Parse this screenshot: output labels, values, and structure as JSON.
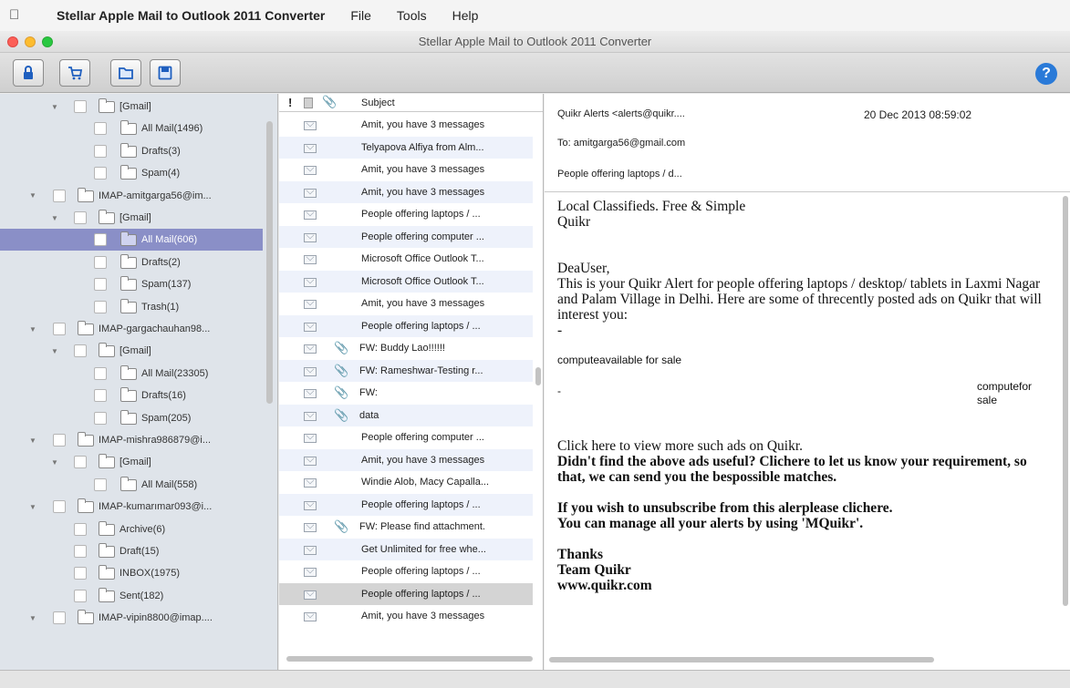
{
  "menubar": {
    "app": "Stellar Apple Mail to Outlook 2011 Converter",
    "items": [
      "File",
      "Tools",
      "Help"
    ]
  },
  "window": {
    "title": "Stellar Apple Mail to Outlook 2011 Converter"
  },
  "toolbar": {
    "help": "?"
  },
  "tree": [
    {
      "label": "[Gmail]",
      "level": 2,
      "expanded": true
    },
    {
      "label": "All Mail(1496)",
      "level": 3
    },
    {
      "label": "Drafts(3)",
      "level": 3
    },
    {
      "label": "Spam(4)",
      "level": 3
    },
    {
      "label": "IMAP-amitgarga56@im...",
      "level": 1,
      "expanded": true,
      "account": true
    },
    {
      "label": "[Gmail]",
      "level": 2,
      "expanded": true
    },
    {
      "label": "All Mail(606)",
      "level": 3,
      "selected": true
    },
    {
      "label": "Drafts(2)",
      "level": 3
    },
    {
      "label": "Spam(137)",
      "level": 3
    },
    {
      "label": "Trash(1)",
      "level": 3
    },
    {
      "label": "IMAP-gargachauhan98...",
      "level": 1,
      "expanded": true,
      "account": true
    },
    {
      "label": "[Gmail]",
      "level": 2,
      "expanded": true
    },
    {
      "label": "All Mail(23305)",
      "level": 3
    },
    {
      "label": "Drafts(16)",
      "level": 3
    },
    {
      "label": "Spam(205)",
      "level": 3
    },
    {
      "label": "IMAP-mishra986879@i...",
      "level": 1,
      "expanded": true,
      "account": true
    },
    {
      "label": "[Gmail]",
      "level": 2,
      "expanded": true
    },
    {
      "label": "All Mail(558)",
      "level": 3
    },
    {
      "label": "IMAP-kumarımar093@i...",
      "level": 1,
      "expanded": true,
      "account": true
    },
    {
      "label": "Archive(6)",
      "level": 2
    },
    {
      "label": "Draft(15)",
      "level": 2
    },
    {
      "label": "INBOX(1975)",
      "level": 2
    },
    {
      "label": "Sent(182)",
      "level": 2
    },
    {
      "label": "IMAP-vipin8800@imap....",
      "level": 1,
      "expanded": true,
      "account": true
    }
  ],
  "list": {
    "header": {
      "flag": "!",
      "subject": "Subject"
    },
    "rows": [
      {
        "subject": "Amit, you have 3 messages",
        "att": false
      },
      {
        "subject": "Telyapova Alfiya from Alm...",
        "att": false
      },
      {
        "subject": "Amit, you have 3 messages",
        "att": false
      },
      {
        "subject": "Amit, you have 3 messages",
        "att": false
      },
      {
        "subject": "People offering laptops / ...",
        "att": false
      },
      {
        "subject": "People offering computer ...",
        "att": false
      },
      {
        "subject": "Microsoft Office Outlook T...",
        "att": false
      },
      {
        "subject": "Microsoft Office Outlook T...",
        "att": false
      },
      {
        "subject": "Amit, you have 3 messages",
        "att": false
      },
      {
        "subject": "People offering laptops / ...",
        "att": false
      },
      {
        "subject": "FW: Buddy Lao!!!!!!",
        "att": true
      },
      {
        "subject": "FW: Rameshwar-Testing r...",
        "att": true
      },
      {
        "subject": "FW:",
        "att": true
      },
      {
        "subject": "data",
        "att": true
      },
      {
        "subject": "People offering computer ...",
        "att": false
      },
      {
        "subject": "Amit, you have 3 messages",
        "att": false
      },
      {
        "subject": "Windie Alob, Macy Capalla...",
        "att": false
      },
      {
        "subject": "People offering laptops / ...",
        "att": false
      },
      {
        "subject": "FW: Please find attachment.",
        "att": true
      },
      {
        "subject": "Get Unlimited for free whe...",
        "att": false
      },
      {
        "subject": "People offering laptops / ...",
        "att": false
      },
      {
        "subject": "People offering laptops / ...",
        "att": false,
        "selected": true
      },
      {
        "subject": "Amit, you have 3 messages",
        "att": false
      }
    ]
  },
  "preview": {
    "from": "Quikr Alerts <alerts@quikr....",
    "date": "20 Dec 2013 08:59:02",
    "to": "To: amitgarga56@gmail.com",
    "subject": "People offering laptops / d...",
    "body": {
      "l1": "Local Classifieds. Free & Simple",
      "l2": "Quikr",
      "greet": "DeaUser,",
      "p1": "This is your Quikr Alert for people offering laptops / desktop/ tablets in Laxmi Nagar and Palam Village in Delhi. Here are some of threcently posted ads on Quikr that will interest you:",
      "dash1": "-",
      "item1": "computeavailable for sale",
      "dash2": "-",
      "item2": "computefor sale",
      "click": "Click here to view more such ads on Quikr.",
      "b1": "Didn't find the above ads useful? Clichere to let us know your requirement, so that, we can send you the bespossible matches.",
      "b2": "If you wish to unsubscribe from this alerplease clichere.",
      "b3": "You can manage all your alerts by using 'MQuikr'.",
      "t1": "Thanks",
      "t2": "Team Quikr",
      "t3": "www.quikr.com"
    }
  }
}
